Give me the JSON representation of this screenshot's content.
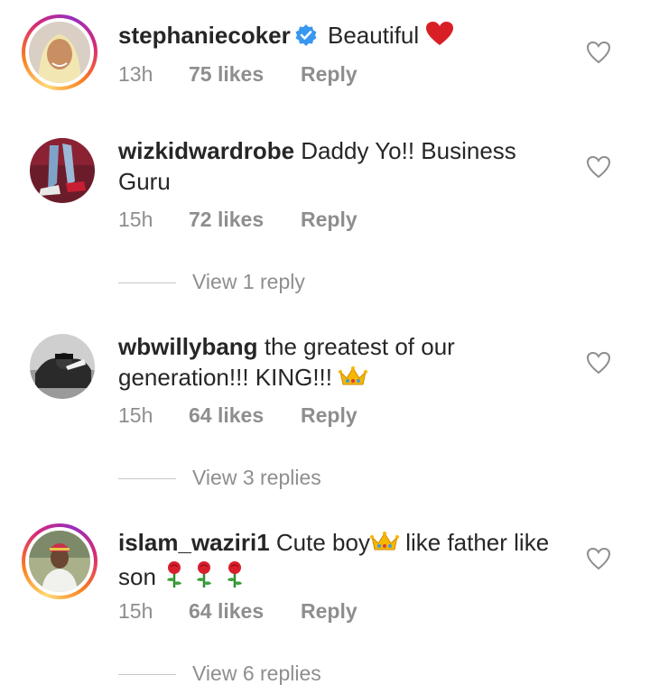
{
  "colors": {
    "text": "#262626",
    "muted": "#8e8e8e",
    "verified": "#3897f0",
    "heart_red": "#e0245e",
    "crown_gold": "#f5b700",
    "rose_red": "#d81e2c"
  },
  "comments": [
    {
      "username": "stephaniecoker",
      "verified": true,
      "text": "Beautiful",
      "emoji": "red-heart",
      "time": "13h",
      "likes": "75 likes",
      "reply_label": "Reply"
    },
    {
      "username": "wizkidwardrobe",
      "verified": false,
      "text": "Daddy Yo!! Business Guru",
      "time": "15h",
      "likes": "72 likes",
      "reply_label": "Reply",
      "view_replies": "View 1 reply"
    },
    {
      "username": "wbwillybang",
      "verified": false,
      "text": "the greatest of our generation!!! KING!!!",
      "emoji": "crown",
      "time": "15h",
      "likes": "64 likes",
      "reply_label": "Reply",
      "view_replies": "View 3 replies"
    },
    {
      "username": "islam_waziri1",
      "verified": false,
      "text_before": "Cute boy",
      "text_after": "like father like son",
      "emoji": [
        "crown",
        "rose",
        "rose",
        "rose"
      ],
      "time": "15h",
      "likes": "64 likes",
      "reply_label": "Reply",
      "view_replies": "View 6 replies"
    }
  ]
}
